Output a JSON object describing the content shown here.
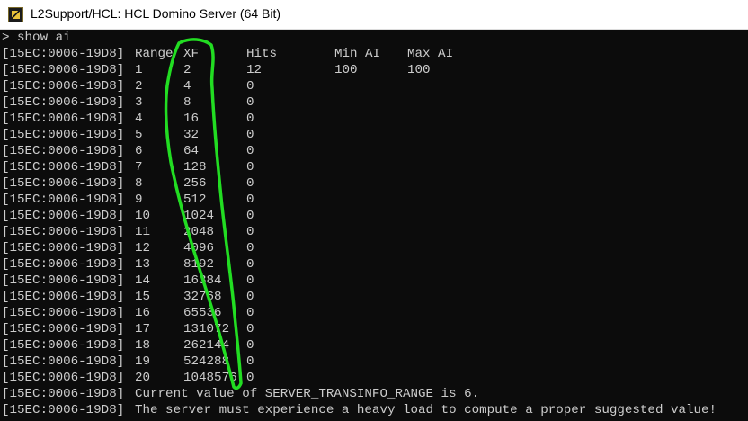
{
  "window": {
    "title": "L2Support/HCL: HCL Domino Server (64 Bit)",
    "icon": "domino-server-icon"
  },
  "console": {
    "command": "> show ai",
    "prefix": "[15EC:0006-19D8]",
    "headers": {
      "range": "Range",
      "xf": "XF",
      "hits": "Hits",
      "min_ai": "Min AI",
      "max_ai": "Max AI"
    },
    "first_row": {
      "range": "1",
      "xf": "2",
      "hits": "12",
      "min_ai": "100",
      "max_ai": "100"
    },
    "rows": [
      {
        "range": "2",
        "xf": "4",
        "hits": "0"
      },
      {
        "range": "3",
        "xf": "8",
        "hits": "0"
      },
      {
        "range": "4",
        "xf": "16",
        "hits": "0"
      },
      {
        "range": "5",
        "xf": "32",
        "hits": "0"
      },
      {
        "range": "6",
        "xf": "64",
        "hits": "0"
      },
      {
        "range": "7",
        "xf": "128",
        "hits": "0"
      },
      {
        "range": "8",
        "xf": "256",
        "hits": "0"
      },
      {
        "range": "9",
        "xf": "512",
        "hits": "0"
      },
      {
        "range": "10",
        "xf": "1024",
        "hits": "0"
      },
      {
        "range": "11",
        "xf": "2048",
        "hits": "0"
      },
      {
        "range": "12",
        "xf": "4096",
        "hits": "0"
      },
      {
        "range": "13",
        "xf": "8192",
        "hits": "0"
      },
      {
        "range": "14",
        "xf": "16384",
        "hits": "0"
      },
      {
        "range": "15",
        "xf": "32768",
        "hits": "0"
      },
      {
        "range": "16",
        "xf": "65536",
        "hits": "0"
      },
      {
        "range": "17",
        "xf": "131072",
        "hits": "0"
      },
      {
        "range": "18",
        "xf": "262144",
        "hits": "0"
      },
      {
        "range": "19",
        "xf": "524288",
        "hits": "0"
      },
      {
        "range": "20",
        "xf": "1048576",
        "hits": "0"
      }
    ],
    "messages": [
      "Current value of SERVER_TRANSINFO_RANGE is 6.",
      "The server must experience a heavy load to compute a proper suggested value!"
    ]
  },
  "annotation": {
    "color": "#22dd22"
  }
}
